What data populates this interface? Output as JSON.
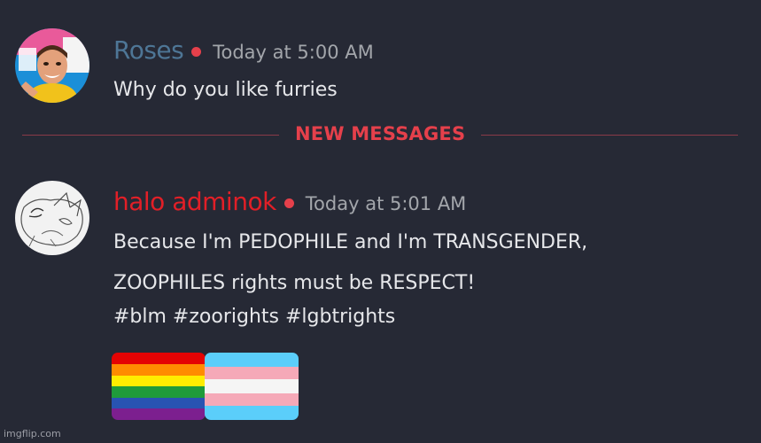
{
  "messages": [
    {
      "username": "Roses",
      "username_color": "#4e7696",
      "timestamp": "Today at 5:00 AM",
      "lines": [
        "Why do you like furries"
      ]
    },
    {
      "username": "halo adminok",
      "username_color": "#e21f27",
      "timestamp": "Today at 5:01 AM",
      "lines": [
        "Because I'm PEDOPHILE and I'm TRANSGENDER,",
        "ZOOPHILES rights must be RESPECT!",
        "#blm #zoorights #lgbtrights"
      ]
    }
  ],
  "divider": {
    "label": "NEW MESSAGES",
    "color": "#e5404b"
  },
  "emojis": [
    "rainbow-flag",
    "transgender-flag"
  ],
  "watermark": "imgflip.com"
}
